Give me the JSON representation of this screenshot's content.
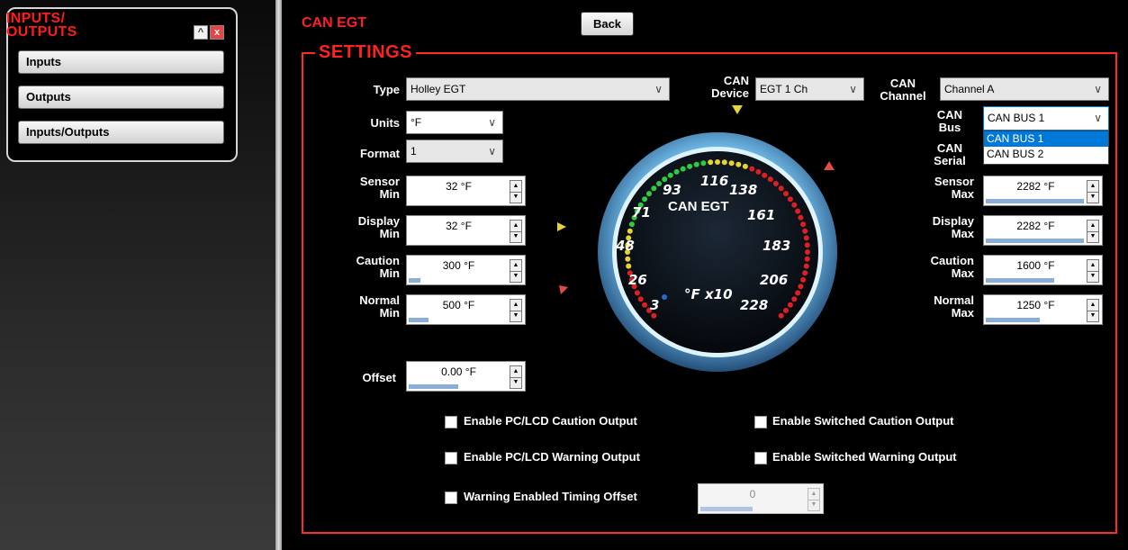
{
  "left_panel": {
    "title_line1": "INPUTS/",
    "title_line2": "OUTPUTS",
    "collapse_glyph": "^",
    "close_glyph": "x",
    "nav": [
      "Inputs",
      "Outputs",
      "Inputs/Outputs"
    ]
  },
  "header": {
    "title": "CAN EGT",
    "back_label": "Back"
  },
  "settings": {
    "title": "SETTINGS",
    "type": {
      "label": "Type",
      "value": "Holley EGT"
    },
    "can_device": {
      "label1": "CAN",
      "label2": "Device",
      "value": "EGT 1 Ch"
    },
    "can_channel": {
      "label1": "CAN",
      "label2": "Channel",
      "value": "Channel A"
    },
    "can_bus": {
      "label1": "CAN",
      "label2": "Bus",
      "value": "CAN BUS 1",
      "options": [
        "CAN BUS 1",
        "CAN BUS 2"
      ]
    },
    "can_serial": {
      "label1": "CAN",
      "label2": "Serial"
    },
    "units": {
      "label": "Units",
      "value": "°F"
    },
    "format": {
      "label": "Format",
      "value": "1"
    },
    "sensor_min": {
      "label1": "Sensor",
      "label2": "Min",
      "value": "32 °F",
      "level": 0
    },
    "display_min": {
      "label1": "Display",
      "label2": "Min",
      "value": "32 °F",
      "level": 0
    },
    "caution_min": {
      "label1": "Caution",
      "label2": "Min",
      "value": "300 °F",
      "level": 0.12
    },
    "normal_min": {
      "label1": "Normal",
      "label2": "Min",
      "value": "500 °F",
      "level": 0.2
    },
    "sensor_max": {
      "label1": "Sensor",
      "label2": "Max",
      "value": "2282 °F",
      "level": 1
    },
    "display_max": {
      "label1": "Display",
      "label2": "Max",
      "value": "2282 °F",
      "level": 1
    },
    "caution_max": {
      "label1": "Caution",
      "label2": "Max",
      "value": "1600 °F",
      "level": 0.7
    },
    "normal_max": {
      "label1": "Normal",
      "label2": "Max",
      "value": "1250 °F",
      "level": 0.55
    },
    "offset": {
      "label": "Offset",
      "value": "0.00 °F",
      "level": 0.5
    },
    "timing_offset": {
      "value": "0",
      "level": 0.5
    },
    "checkboxes": {
      "pc_caution": "Enable PC/LCD Caution Output",
      "pc_warning": "Enable PC/LCD Warning Output",
      "timing": "Warning Enabled Timing Offset",
      "sw_caution": "Enable Switched Caution Output",
      "sw_warning": "Enable Switched Warning Output"
    }
  },
  "gauge": {
    "title": "CAN EGT",
    "unit": "°F x10",
    "ticks": [
      "3",
      "26",
      "48",
      "71",
      "93",
      "116",
      "138",
      "161",
      "183",
      "206",
      "228"
    ]
  },
  "colors": {
    "accent": "#ff2222",
    "bar": "#8aaed8",
    "selection": "#0078d7"
  },
  "icons": [
    "chevron-down-icon",
    "spin-up-icon",
    "spin-down-icon",
    "marker-triangle-icon",
    "close-icon",
    "collapse-icon"
  ]
}
